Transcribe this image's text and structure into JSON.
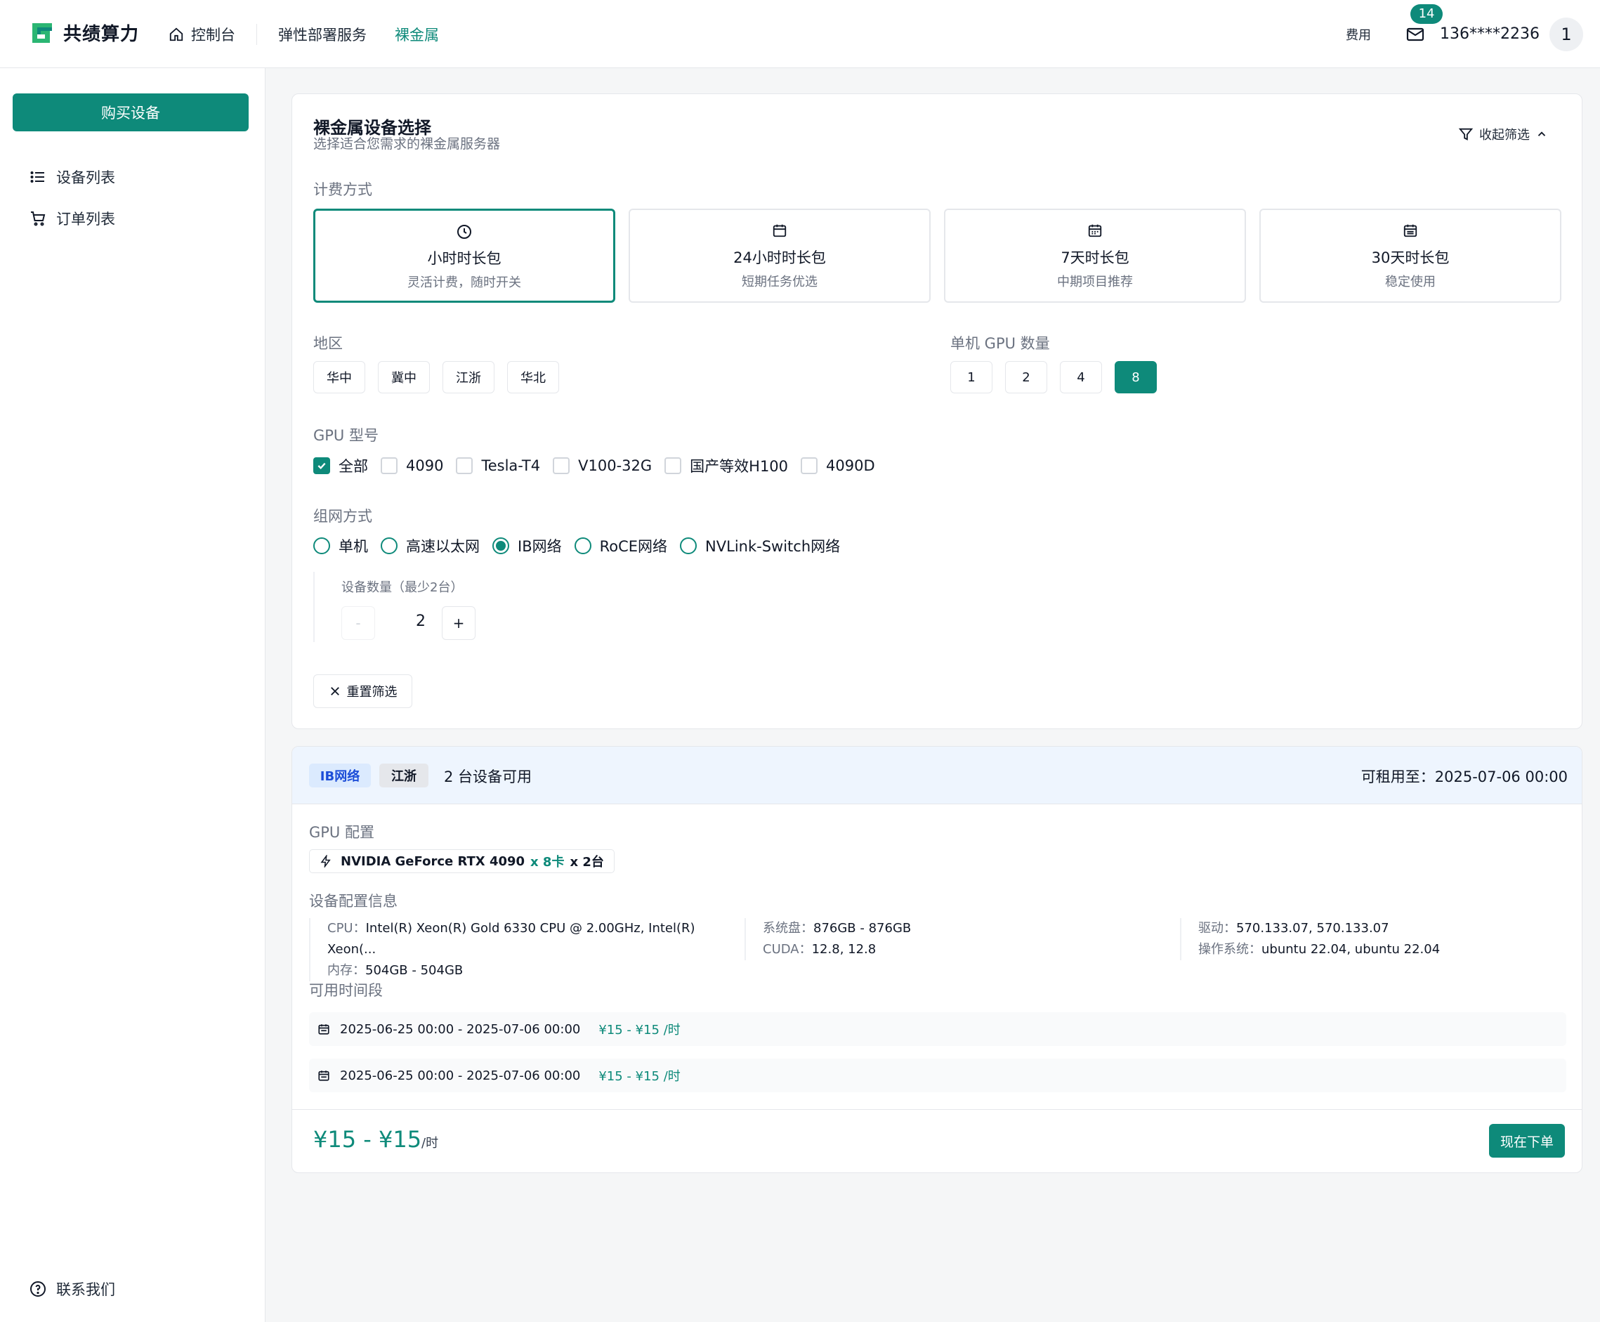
{
  "header": {
    "brand": "共绩算力",
    "nav": [
      {
        "label": "控制台"
      },
      {
        "label": "弹性部署服务"
      },
      {
        "label": "裸金属"
      }
    ],
    "fee_label": "费用",
    "mail_count": "14",
    "user": "136****2236",
    "avatar_initial": "1",
    "accent_color": "#0e8a7a"
  },
  "sidebar": {
    "buy_label": "购买设备",
    "items": [
      {
        "label": "设备列表",
        "icon": "list-icon"
      },
      {
        "label": "订单列表",
        "icon": "cart-icon"
      }
    ],
    "contact_label": "联系我们"
  },
  "filter": {
    "title": "裸金属设备选择",
    "subtitle": "选择适合您需求的裸金属服务器",
    "collapse_label": "收起筛选",
    "billing_label": "计费方式",
    "billing": [
      {
        "title": "小时时长包",
        "desc": "灵活计费，随时开关",
        "selected": true
      },
      {
        "title": "24小时时长包",
        "desc": "短期任务优选",
        "selected": false
      },
      {
        "title": "7天时长包",
        "desc": "中期项目推荐",
        "selected": false
      },
      {
        "title": "30天时长包",
        "desc": "稳定使用",
        "selected": false
      }
    ],
    "region_label": "地区",
    "regions": [
      "华中",
      "冀中",
      "江浙",
      "华北"
    ],
    "gpu_count_label": "单机 GPU 数量",
    "gpu_counts": [
      "1",
      "2",
      "4",
      "8"
    ],
    "gpu_count_selected": "8",
    "gpu_model_label": "GPU 型号",
    "gpu_models": [
      {
        "label": "全部",
        "checked": true
      },
      {
        "label": "4090",
        "checked": false
      },
      {
        "label": "Tesla-T4",
        "checked": false
      },
      {
        "label": "V100-32G",
        "checked": false
      },
      {
        "label": "国产等效H100",
        "checked": false
      },
      {
        "label": "4090D",
        "checked": false
      }
    ],
    "network_label": "组网方式",
    "networks": [
      {
        "label": "单机",
        "selected": false
      },
      {
        "label": "高速以太网",
        "selected": false
      },
      {
        "label": "IB网络",
        "selected": true
      },
      {
        "label": "RoCE网络",
        "selected": false
      },
      {
        "label": "NVLink-Switch网络",
        "selected": false
      }
    ],
    "qty_label": "设备数量（最少2台）",
    "qty_minus": "-",
    "qty_value": "2",
    "qty_plus": "+",
    "reset_label": "重置筛选"
  },
  "result": {
    "tag_network": "IB网络",
    "tag_region": "江浙",
    "available": "2 台设备可用",
    "rent_until": "可租用至：2025-07-06 00:00",
    "gpu_config_label": "GPU 配置",
    "gpu_name": "NVIDIA GeForce RTX 4090",
    "gpu_cards": "x 8卡",
    "gpu_units": "x 2台",
    "device_info_label": "设备配置信息",
    "cpu_key": "CPU：",
    "cpu_val": "Intel(R) Xeon(R) Gold 6330 CPU @ 2.00GHz, Intel(R) Xeon(...",
    "mem_key": "内存：",
    "mem_val": "504GB - 504GB",
    "disk_key": "系统盘：",
    "disk_val": "876GB - 876GB",
    "cuda_key": "CUDA：",
    "cuda_val": "12.8, 12.8",
    "driver_key": "驱动：",
    "driver_val": "570.133.07, 570.133.07",
    "os_key": "操作系统：",
    "os_val": "ubuntu 22.04, ubuntu 22.04",
    "slots_label": "可用时间段",
    "slots": [
      {
        "range": "2025-06-25 00:00 - 2025-07-06 00:00",
        "price": "¥15 - ¥15 /时"
      },
      {
        "range": "2025-06-25 00:00 - 2025-07-06 00:00",
        "price": "¥15 - ¥15 /时"
      }
    ],
    "price": "¥15 - ¥15",
    "price_unit": "/时",
    "order_label": "现在下单"
  }
}
